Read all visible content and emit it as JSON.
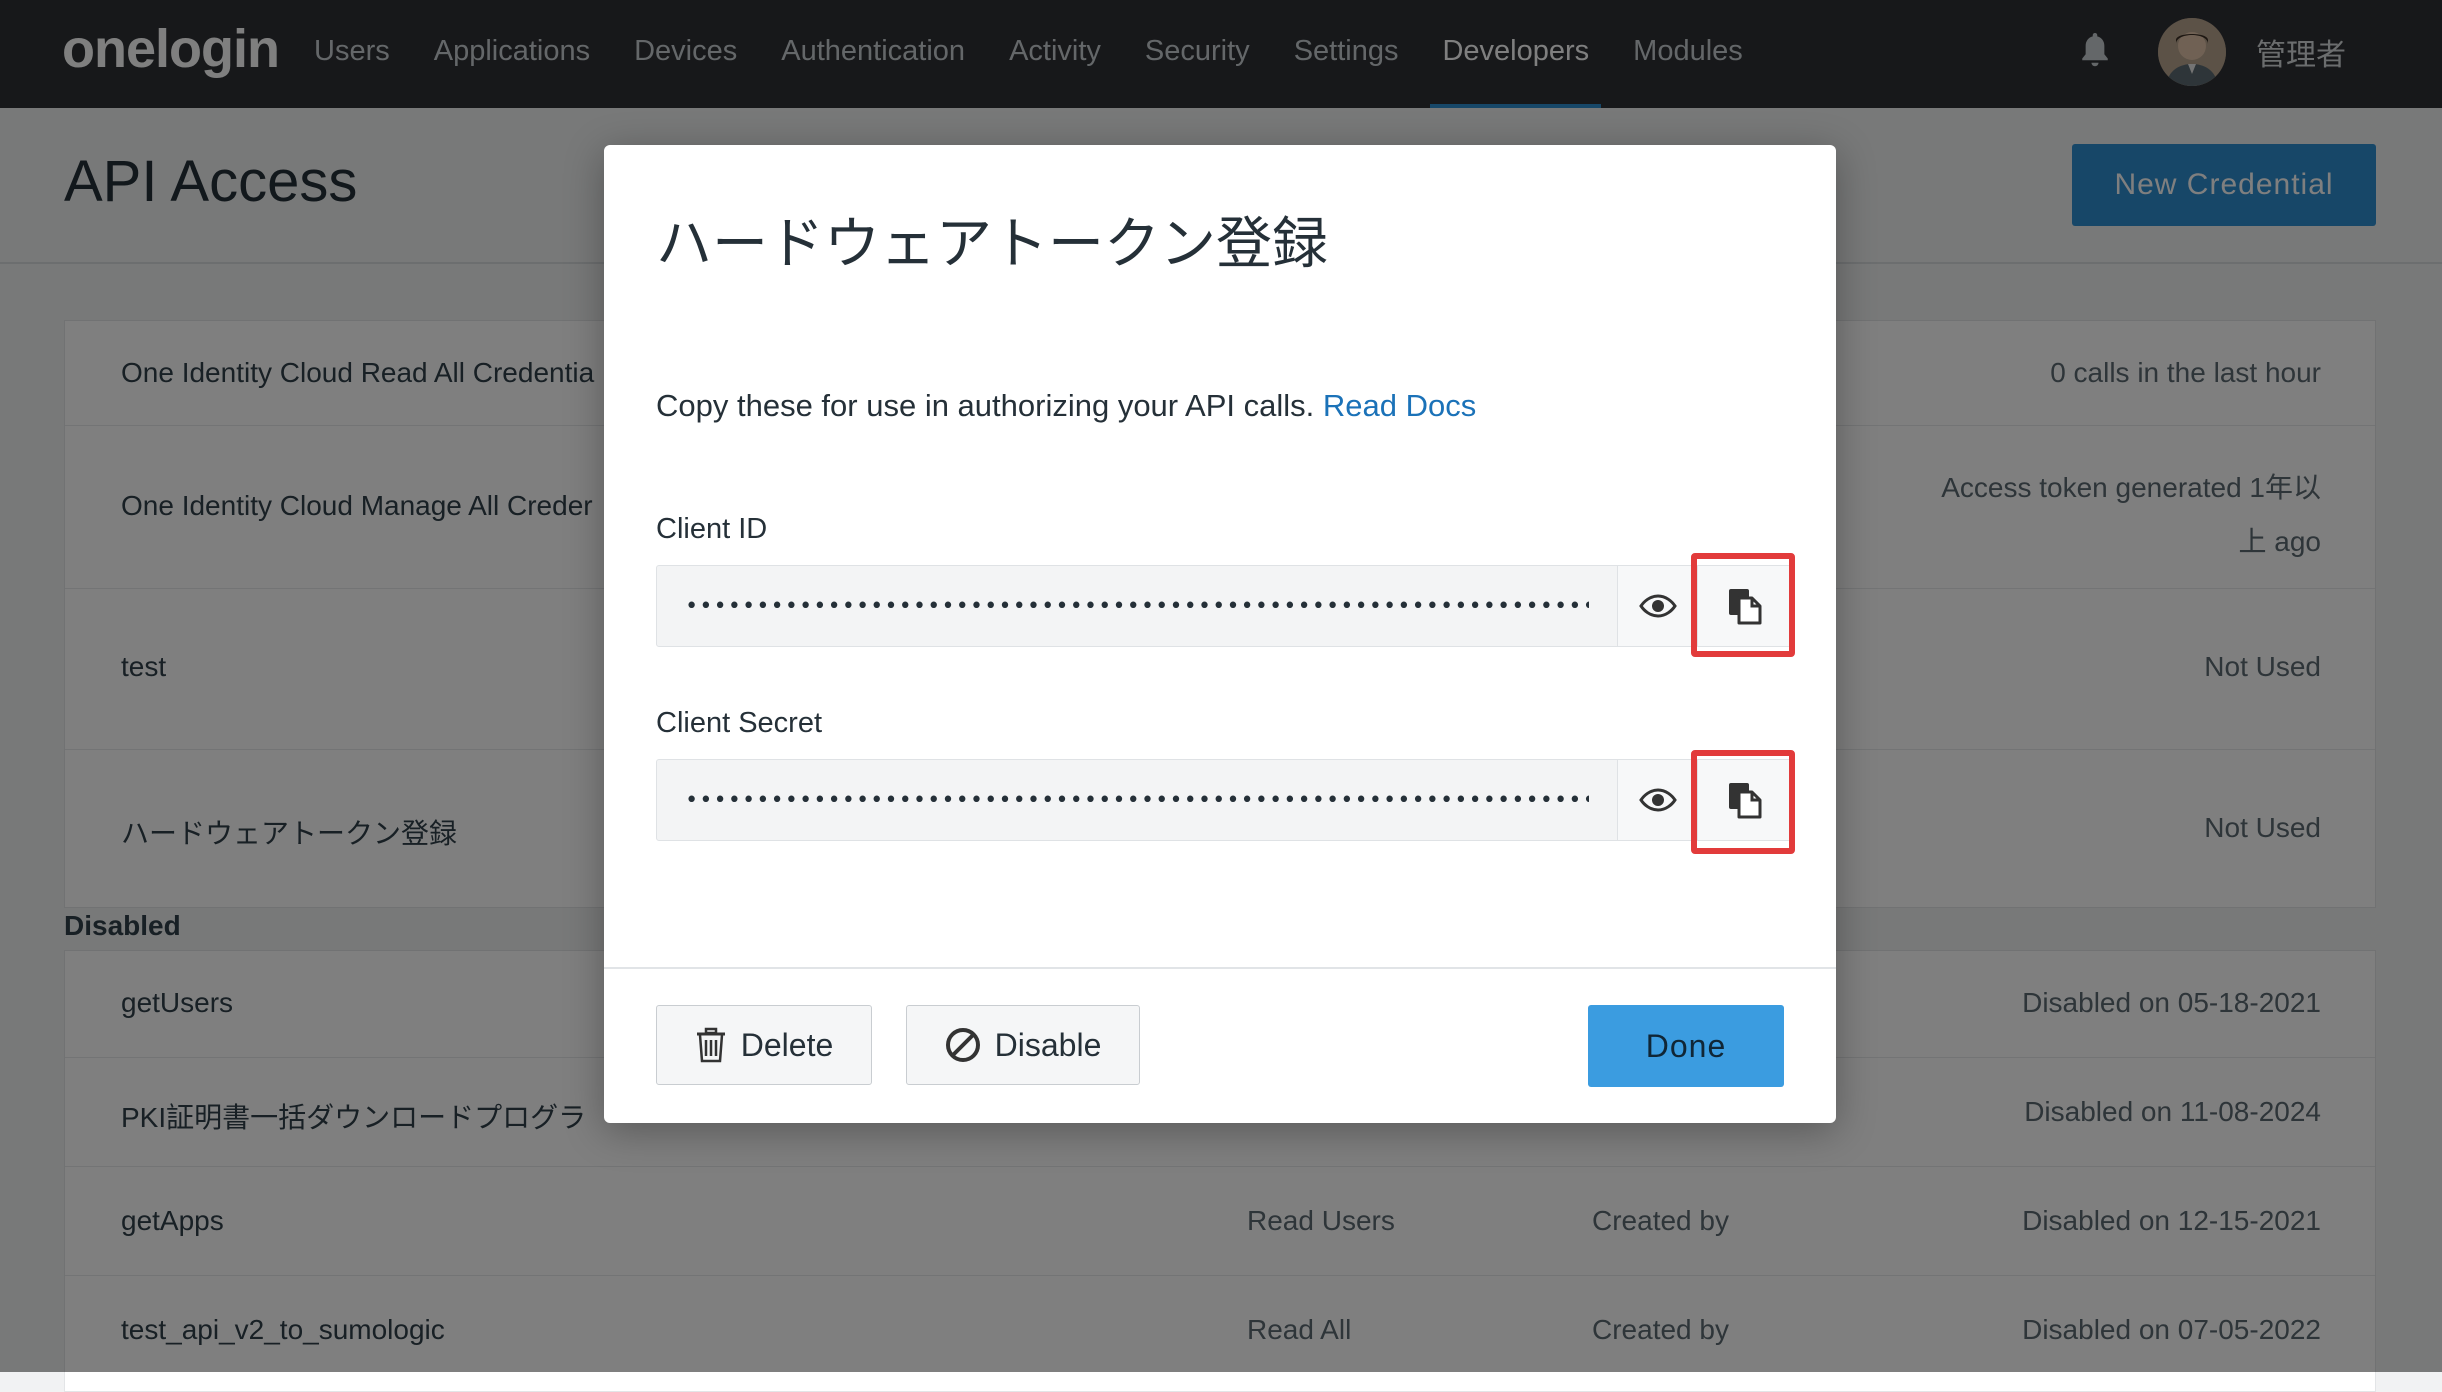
{
  "nav": {
    "logo": "onelogin",
    "items": [
      "Users",
      "Applications",
      "Devices",
      "Authentication",
      "Activity",
      "Security",
      "Settings",
      "Developers",
      "Modules"
    ],
    "active": "Developers",
    "user_name": "管理者"
  },
  "page": {
    "title": "API Access",
    "new_credential_label": "New Credential"
  },
  "enabled_rows": [
    {
      "name": "One Identity Cloud Read All Credentia",
      "status": "0 calls in the last hour"
    },
    {
      "name": "One Identity Cloud Manage All Creder",
      "status_line1": "Access token generated 1年以",
      "status_line2": "上 ago"
    },
    {
      "name": "test",
      "status": "Not Used"
    },
    {
      "name": "ハードウェアトークン登録",
      "status": "Not Used"
    }
  ],
  "disabled_section_label": "Disabled",
  "disabled_rows": [
    {
      "name": "getUsers",
      "scope": "",
      "created": "",
      "status": "Disabled on 05-18-2021"
    },
    {
      "name": "PKI証明書一括ダウンロードプログラ",
      "scope": "",
      "created": "",
      "status": "Disabled on 11-08-2024"
    },
    {
      "name": "getApps",
      "scope": "Read Users",
      "created": "Created by",
      "status": "Disabled on 12-15-2021"
    },
    {
      "name": "test_api_v2_to_sumologic",
      "scope": "Read All",
      "created": "Created by",
      "status": "Disabled on 07-05-2022"
    }
  ],
  "modal": {
    "title": "ハードウェアトークン登録",
    "description": "Copy these for use in authorizing your API calls.",
    "docs_link": "Read Docs",
    "client_id_label": "Client ID",
    "client_id_value": "••••••••••••••••••••••••••••••••••••••••••••••••••••••••••••••••",
    "client_secret_label": "Client Secret",
    "client_secret_value": "••••••••••••••••••••••••••••••••••••••••••••••••••••••••••••••••",
    "delete_label": "Delete",
    "disable_label": "Disable",
    "done_label": "Done"
  },
  "colors": {
    "nav_bg": "#2e3135",
    "accent": "#2f8fd1",
    "done_button": "#3b9ce0",
    "highlight": "#e23b3b",
    "link": "#1b72b8"
  },
  "icons": [
    "bell-icon",
    "eye-icon",
    "copy-icon",
    "trash-icon",
    "disable-icon"
  ]
}
